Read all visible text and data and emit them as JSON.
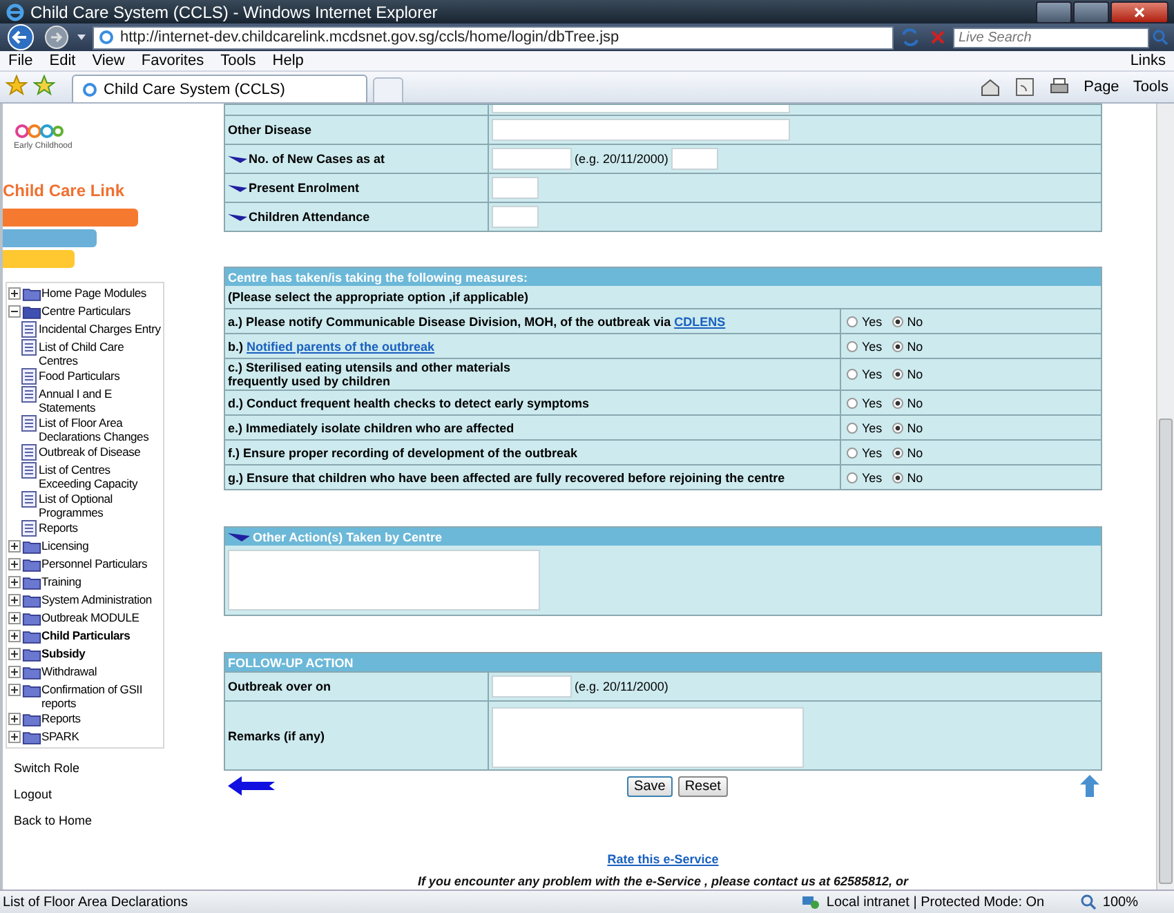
{
  "window": {
    "title": "Child Care System (CCLS) - Windows Internet Explorer"
  },
  "address_bar": {
    "url": "http://internet-dev.childcarelink.mcdsnet.gov.sg/ccls/home/login/dbTree.jsp",
    "search_placeholder": "Live Search"
  },
  "menu": [
    "File",
    "Edit",
    "View",
    "Favorites",
    "Tools",
    "Help"
  ],
  "links_label": "Links",
  "browser_tab": {
    "title": "Child Care System (CCLS)"
  },
  "toolbar": {
    "page": "Page",
    "tools": "Tools"
  },
  "sidebar": {
    "logo_text": "Early Childhood",
    "brand": "Child Care Link",
    "tree": [
      {
        "label": "Home Page Modules",
        "bold": false,
        "expanded": false
      },
      {
        "label": "Centre Particulars",
        "bold": false,
        "expanded": true,
        "children": [
          {
            "label": "Incidental Charges Entry"
          },
          {
            "label": "List of Child Care Centres"
          },
          {
            "label": "Food Particulars"
          },
          {
            "label": "Annual I and E Statements"
          },
          {
            "label": "List of Floor Area Declarations Changes"
          },
          {
            "label": "Outbreak of Disease"
          },
          {
            "label": "List of Centres Exceeding Capacity"
          },
          {
            "label": "List of Optional Programmes"
          },
          {
            "label": "Reports"
          }
        ]
      },
      {
        "label": "Licensing",
        "bold": false,
        "expanded": false
      },
      {
        "label": "Personnel Particulars",
        "bold": false,
        "expanded": false
      },
      {
        "label": "Training",
        "bold": false,
        "expanded": false
      },
      {
        "label": "System Administration",
        "bold": false,
        "expanded": false
      },
      {
        "label": "Outbreak MODULE",
        "bold": false,
        "expanded": false
      },
      {
        "label": "Child Particulars",
        "bold": true,
        "expanded": false
      },
      {
        "label": "Subsidy",
        "bold": true,
        "expanded": false
      },
      {
        "label": "Withdrawal",
        "bold": false,
        "expanded": false
      },
      {
        "label": "Confirmation of GSII reports",
        "bold": false,
        "expanded": false
      },
      {
        "label": "Reports",
        "bold": false,
        "expanded": false
      },
      {
        "label": "SPARK",
        "bold": false,
        "expanded": false
      }
    ],
    "links": [
      "Switch Role",
      "Logout",
      "Back to Home"
    ]
  },
  "details": {
    "rows": [
      {
        "required": false,
        "fields": [
          {
            "kind": "text"
          }
        ]
      },
      {
        "label": "Other Disease",
        "required": false,
        "fields": [
          {
            "kind": "text"
          }
        ]
      },
      {
        "label": "No. of New Cases as at",
        "required": true,
        "fields": [
          {
            "kind": "date",
            "hint": "(e.g. 20/11/2000)"
          },
          {
            "kind": "number"
          }
        ]
      },
      {
        "label": "Present Enrolment",
        "required": true,
        "fields": [
          {
            "kind": "short"
          }
        ]
      },
      {
        "label": "Children Attendance",
        "required": true,
        "fields": [
          {
            "kind": "short"
          }
        ]
      }
    ]
  },
  "measures": {
    "title": "Centre has taken/is taking the following measures:",
    "note": "(Please select the appropriate option ,if applicable)",
    "items": [
      {
        "text": "a.) Please notify Communicable Disease Division, MOH, of the outbreak via",
        "link": "CDLENS",
        "options": [
          {
            "label": "Yes",
            "selected": false
          },
          {
            "label": "No",
            "selected": true
          }
        ]
      },
      {
        "text": "b.)",
        "link": "Notified parents of the outbreak",
        "options": [
          {
            "label": "Yes",
            "selected": false
          },
          {
            "label": "No",
            "selected": true
          }
        ]
      },
      {
        "text": "c.) Sterilised eating utensils and other materials frequently used by children",
        "options": [
          {
            "label": "Yes",
            "selected": false
          },
          {
            "label": "No",
            "selected": true
          }
        ]
      },
      {
        "text": "d.) Conduct frequent health checks to detect early symptoms",
        "options": [
          {
            "label": "Yes",
            "selected": false
          },
          {
            "label": "No",
            "selected": true
          }
        ]
      },
      {
        "text": "e.) Immediately isolate children who are affected",
        "options": [
          {
            "label": "Yes",
            "selected": false
          },
          {
            "label": "No",
            "selected": true
          }
        ]
      },
      {
        "text": "f.)  Ensure proper recording of development of the outbreak",
        "options": [
          {
            "label": "Yes",
            "selected": false
          },
          {
            "label": "No",
            "selected": true
          }
        ]
      },
      {
        "text": "g.) Ensure that children who have been affected are fully recovered before rejoining the centre",
        "options": [
          {
            "label": "Yes",
            "selected": false
          },
          {
            "label": "No",
            "selected": true
          }
        ]
      }
    ]
  },
  "other_actions": {
    "title": "Other Action(s) Taken by Centre"
  },
  "follow_up": {
    "title": "FOLLOW-UP ACTION",
    "rows": [
      {
        "label": "Outbreak over on",
        "fields": [
          {
            "kind": "date",
            "hint": "(e.g. 20/11/2000)"
          }
        ]
      },
      {
        "label": "Remarks (if any)",
        "fields": [
          {
            "kind": "textarea"
          }
        ]
      }
    ]
  },
  "buttons": [
    "Save",
    "Reset"
  ],
  "footer": {
    "rate_link": "Rate this e-Service",
    "contact": "If you encounter any problem with the e-Service , please contact us at 62585812, or"
  },
  "status_bar": {
    "text": "List of Floor Area Declarations",
    "zone": "Local intranet | Protected Mode: On",
    "zoom": "100%"
  }
}
